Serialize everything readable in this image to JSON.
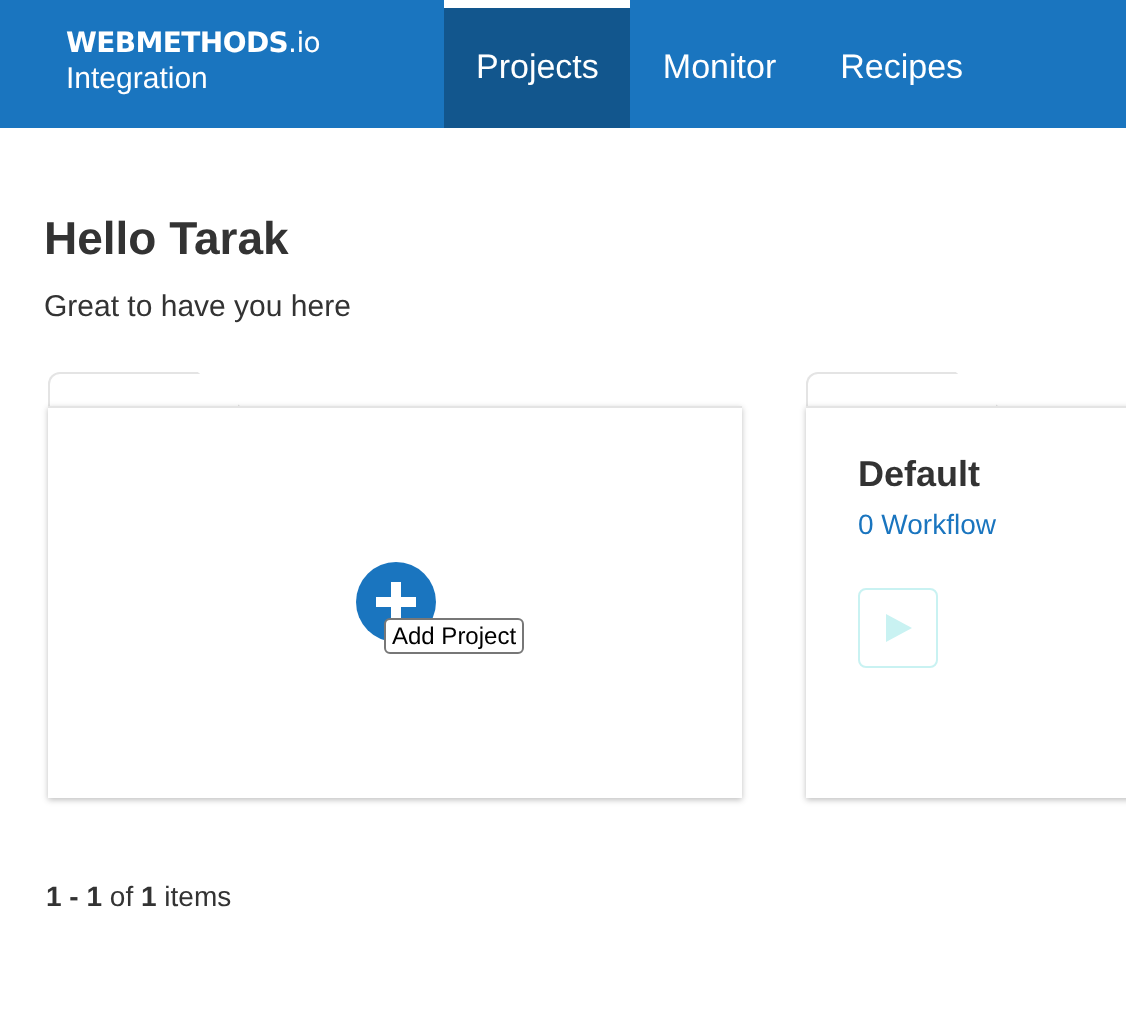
{
  "header": {
    "logo": {
      "brand": "WEBMETHODS",
      "suffix": ".io",
      "product": "Integration"
    },
    "tabs": [
      {
        "label": "Projects",
        "selected": true
      },
      {
        "label": "Monitor",
        "selected": false
      },
      {
        "label": "Recipes",
        "selected": false
      }
    ]
  },
  "greeting": {
    "title": "Hello Tarak",
    "subtitle": "Great to have you here"
  },
  "cards": [
    {
      "kind": "add",
      "tooltip": "Add Project"
    },
    {
      "kind": "project",
      "name": "Default",
      "workflows": "0 Workflow",
      "run_disabled": true
    }
  ],
  "pagination": "**1 - 1** of **1** items"
}
